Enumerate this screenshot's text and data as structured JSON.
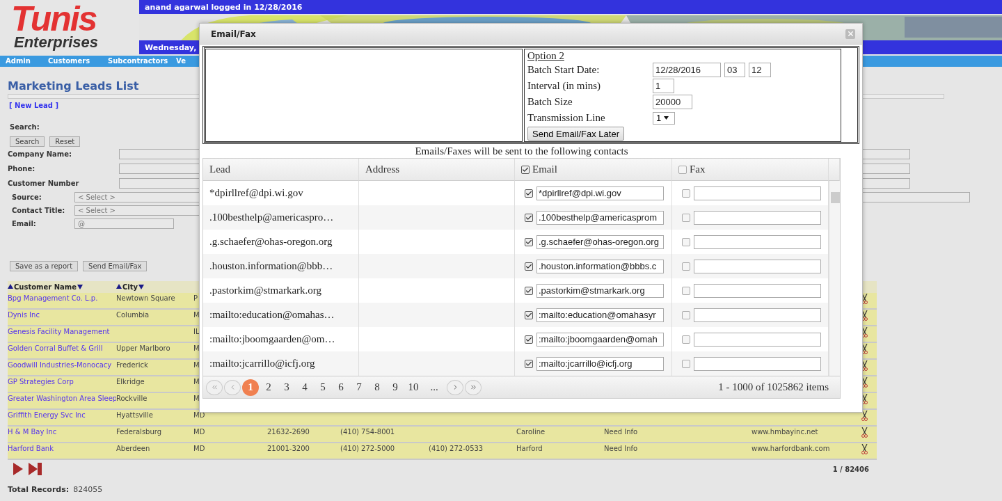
{
  "header": {
    "logo_top": "Tunis",
    "logo_bottom": "Enterprises",
    "user_status": "anand agarwal logged in 12/28/2016",
    "date": "Wednesday,"
  },
  "nav": [
    "Admin",
    "Customers",
    "Subcontractors",
    "Ve"
  ],
  "page": {
    "title": "Marketing Leads List",
    "new_lead": "[ New Lead ]",
    "search_label": "Search:",
    "search_button": "Search",
    "reset_button": "Reset",
    "fields": [
      {
        "kind": "input",
        "label": "Company Name:"
      },
      {
        "kind": "input",
        "label": "Phone:"
      },
      {
        "kind": "input",
        "label": "Customer Number"
      },
      {
        "kind": "select",
        "label": "Source:",
        "value": "< Select >"
      },
      {
        "kind": "select",
        "label": "Contact Title:",
        "value": "< Select >"
      },
      {
        "kind": "email",
        "label": "Email:",
        "value": "@"
      }
    ],
    "save_report": "Save as a report",
    "send_email_fax": "Send Email/Fax"
  },
  "leads_table": {
    "columns": [
      "Customer Name",
      "City"
    ],
    "rows": [
      {
        "name": "Bpg Management Co. L.p.",
        "city": "Newtown Square",
        "state": "P"
      },
      {
        "name": "Dynis Inc",
        "city": "Columbia",
        "state": "M"
      },
      {
        "name": "Genesis Facility Management",
        "state": "IL"
      },
      {
        "name": "Golden Corral Buffet & Grill",
        "city": "Upper Marlboro",
        "state": "M"
      },
      {
        "name": "Goodwill Industries-Monocacy",
        "city": "Frederick",
        "state": "M"
      },
      {
        "name": "GP Strategies Corp",
        "city": "Elkridge",
        "state": "M"
      },
      {
        "name": "Greater Washington Area Sleep",
        "city": "Rockville",
        "state": "M"
      },
      {
        "name": "Griffith Energy Svc Inc",
        "city": "Hyattsville",
        "state": "MD"
      },
      {
        "name": "H & M Bay Inc",
        "city": "Federalsburg",
        "state": "MD",
        "zip": "21632-2690",
        "phone": "(410) 754-8001",
        "county": "Caroline",
        "status": "Need Info",
        "website": "www.hmbayinc.net"
      },
      {
        "name": "Harford Bank",
        "city": "Aberdeen",
        "state": "MD",
        "zip": "21001-3200",
        "phone": "(410) 272-5000",
        "fax": "(410) 272-0533",
        "county": "Harford",
        "status": "Need Info",
        "website": "www.harfordbank.com"
      }
    ],
    "page_count": "1 / 82406",
    "total_label": "Total Records:",
    "total_value": "824055"
  },
  "dialog": {
    "title": "Email/Fax",
    "option_title": "Option 2",
    "batch_start_label": "Batch Start Date:",
    "batch_date": "12/28/2016",
    "batch_hour": "03",
    "batch_minute": "12",
    "interval_label": "Interval (in mins)",
    "interval": "1",
    "batch_size_label": "Batch Size",
    "batch_size": "20000",
    "line_label": "Transmission Line",
    "line": "1",
    "send_later": "Send Email/Fax Later",
    "caption": "Emails/Faxes will be sent to the following contacts",
    "columns": [
      {
        "label": "Lead"
      },
      {
        "label": "Address"
      },
      {
        "label": "Email",
        "checked": true
      },
      {
        "label": "Fax",
        "checked": false
      }
    ],
    "rows": [
      {
        "lead": "*dpirllref@dpi.wi.gov",
        "email_checked": true,
        "email": "*dpirllref@dpi.wi.gov",
        "fax_checked": false
      },
      {
        "lead": ".100besthelp@americaspro…",
        "email_checked": true,
        "email": ".100besthelp@americasprom",
        "fax_checked": false
      },
      {
        "lead": ".g.schaefer@ohas-oregon.org",
        "email_checked": true,
        "email": ".g.schaefer@ohas-oregon.org",
        "fax_checked": false
      },
      {
        "lead": ".houston.information@bbb…",
        "email_checked": true,
        "email": ".houston.information@bbbs.c",
        "fax_checked": false
      },
      {
        "lead": ".pastorkim@stmarkark.org",
        "email_checked": true,
        "email": ".pastorkim@stmarkark.org",
        "fax_checked": false
      },
      {
        "lead": ":mailto:education@omahas…",
        "email_checked": true,
        "email": ":mailto:education@omahasyr",
        "fax_checked": false
      },
      {
        "lead": ":mailto:jboomgaarden@om…",
        "email_checked": true,
        "email": ":mailto:jboomgaarden@omah",
        "fax_checked": false
      },
      {
        "lead": ":mailto:jcarrillo@icfj.org",
        "email_checked": true,
        "email": ":mailto:jcarrillo@icfj.org",
        "fax_checked": false
      }
    ],
    "pages": [
      {
        "label": "1",
        "selected": true
      },
      {
        "label": "2",
        "selected": false
      },
      {
        "label": "3",
        "selected": false
      },
      {
        "label": "4",
        "selected": false
      },
      {
        "label": "5",
        "selected": false
      },
      {
        "label": "6",
        "selected": false
      },
      {
        "label": "7",
        "selected": false
      },
      {
        "label": "8",
        "selected": false
      },
      {
        "label": "9",
        "selected": false
      },
      {
        "label": "10",
        "selected": false
      }
    ],
    "more_pages": "...",
    "items_info": "1 - 1000 of 1025862 items"
  }
}
